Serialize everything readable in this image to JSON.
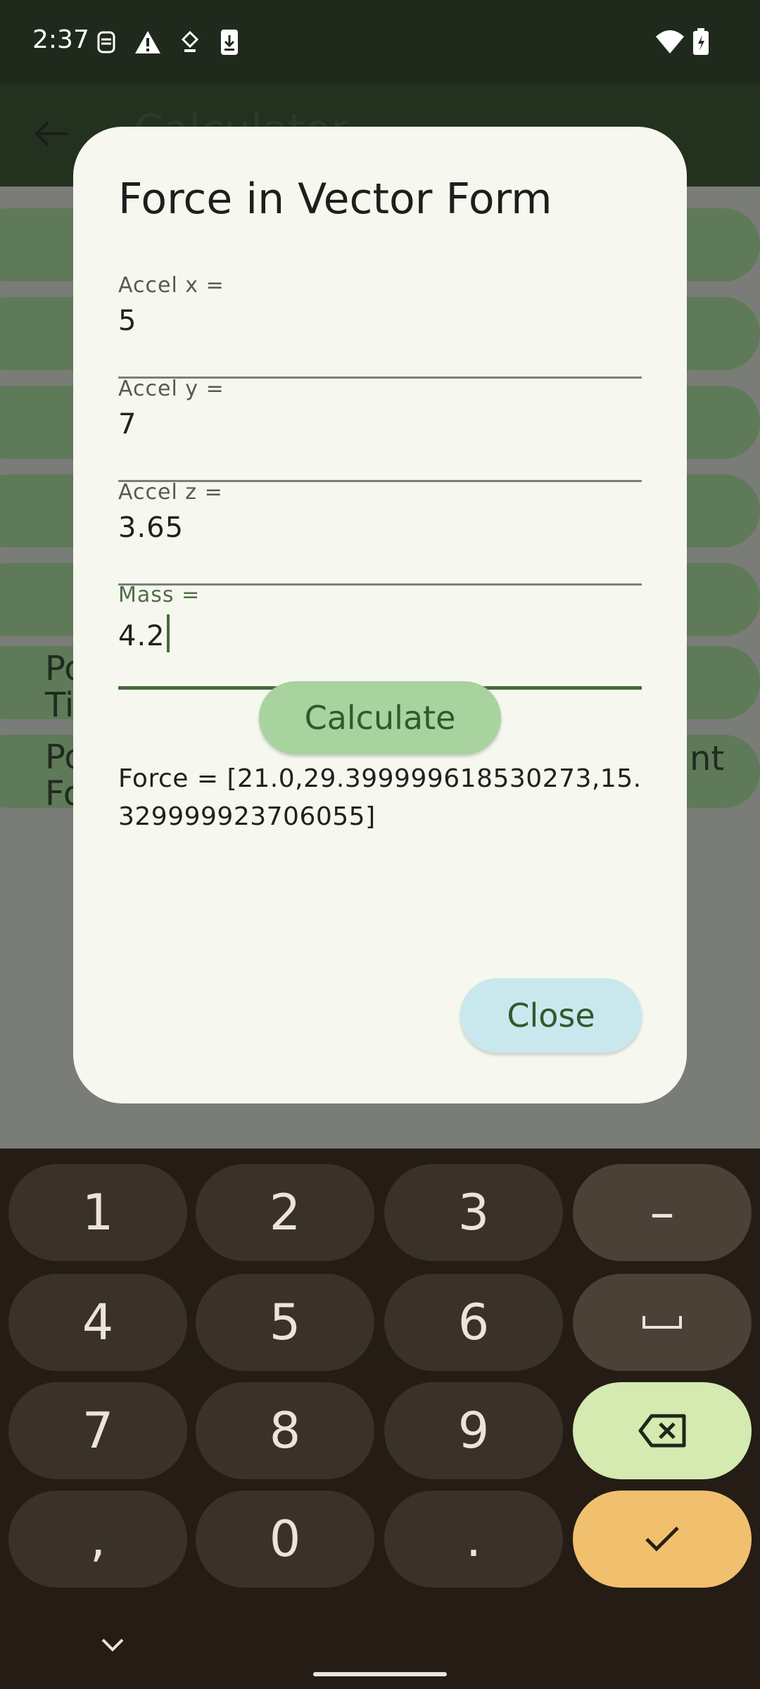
{
  "status": {
    "time": "2:37"
  },
  "appbar": {
    "title": "Calculator"
  },
  "background": {
    "row6_left": "Po\nTi",
    "row7_left": "Po\nFo",
    "row7_right": "nt"
  },
  "dialog": {
    "title": "Force in Vector Form",
    "fields": [
      {
        "label": "Accel x =",
        "value": "5"
      },
      {
        "label": "Accel y =",
        "value": "7"
      },
      {
        "label": "Accel z =",
        "value": "3.65"
      },
      {
        "label": "Mass =",
        "value": "4.2"
      }
    ],
    "calculate_label": "Calculate",
    "result": "Force = [21.0,29.399999618530273,15.329999923706055]",
    "close_label": "Close"
  },
  "keyboard": {
    "keys": [
      "1",
      "2",
      "3",
      "–",
      "4",
      "5",
      "6",
      "␣",
      "7",
      "8",
      "9",
      "⌫",
      ",",
      "0",
      ".",
      "✓"
    ]
  },
  "colors": {
    "accent": "#48693e",
    "dialog_bg": "#f6f8ef",
    "calc_btn": "#a8d39f",
    "close_btn": "#c8e8ee",
    "ok_key": "#f1c06f",
    "del_key": "#d4eab0"
  }
}
